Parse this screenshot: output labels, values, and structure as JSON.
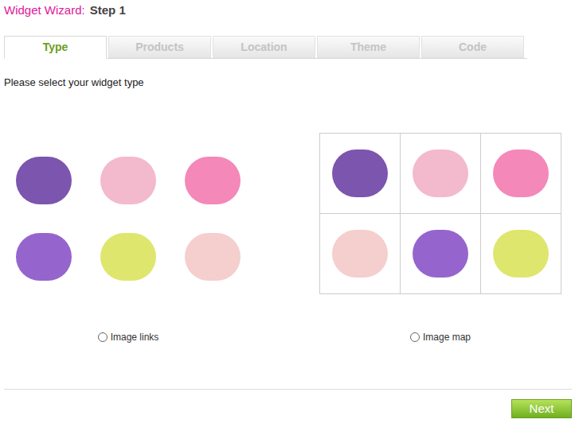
{
  "header": {
    "title": "Widget Wizard:",
    "step": "Step 1"
  },
  "tabs": [
    {
      "label": "Type",
      "selected": true
    },
    {
      "label": "Products",
      "selected": false
    },
    {
      "label": "Location",
      "selected": false
    },
    {
      "label": "Theme",
      "selected": false
    },
    {
      "label": "Code",
      "selected": false
    }
  ],
  "prompt": "Please select your widget type",
  "options": [
    {
      "label": "Image links",
      "kind": "links",
      "selected": false
    },
    {
      "label": "Image map",
      "kind": "map",
      "selected": false
    }
  ],
  "buttons": [
    "Next"
  ]
}
